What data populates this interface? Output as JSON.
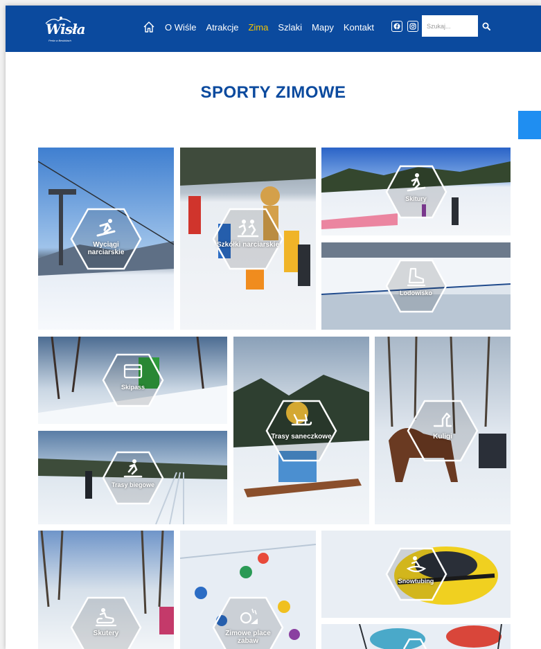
{
  "header": {
    "logo_text": "Wisła",
    "logo_tagline": "Perła w Beskidach",
    "nav": [
      {
        "label": "O Wiśle",
        "active": false
      },
      {
        "label": "Atrakcje",
        "active": false
      },
      {
        "label": "Zima",
        "active": true
      },
      {
        "label": "Szlaki",
        "active": false
      },
      {
        "label": "Mapy",
        "active": false
      },
      {
        "label": "Kontakt",
        "active": false
      }
    ],
    "social": [
      "facebook-icon",
      "instagram-icon"
    ],
    "search_placeholder": "Szukaj..."
  },
  "colors": {
    "primary": "#0b4a9e",
    "active_nav": "#f5c400",
    "side_tab": "#1f8ef1"
  },
  "page_title": "SPORTY ZIMOWE",
  "tiles": [
    {
      "label": "Wyciągi narciarskie",
      "icon": "ski-lift-skier-icon"
    },
    {
      "label": "Szkółki narciarskie",
      "icon": "ski-school-icon"
    },
    {
      "label": "Skitury",
      "icon": "skitour-icon"
    },
    {
      "label": "Lodowisko",
      "icon": "ice-skate-icon"
    },
    {
      "label": "Skipass",
      "icon": "skipass-card-icon"
    },
    {
      "label": "Trasy biegowe",
      "icon": "cross-country-ski-icon"
    },
    {
      "label": "Trasy saneczkowe",
      "icon": "sled-icon"
    },
    {
      "label": "Kuligi",
      "icon": "horse-sleigh-icon"
    },
    {
      "label": "Skutery",
      "icon": "snowmobile-icon"
    },
    {
      "label": "Zimowe place zabaw",
      "icon": "snow-playground-icon"
    },
    {
      "label": "Snowtubing",
      "icon": "snowtubing-icon"
    },
    {
      "label": "",
      "icon": "tube-icon"
    }
  ]
}
